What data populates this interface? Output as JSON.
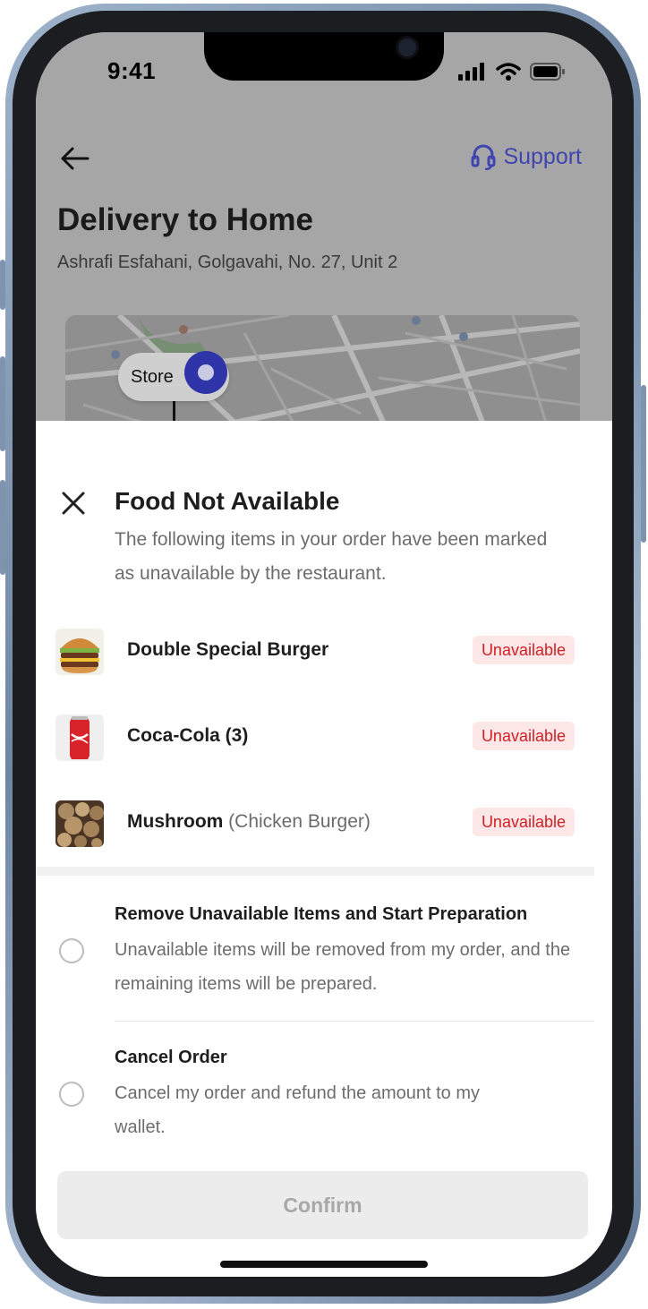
{
  "status_bar": {
    "time": "9:41"
  },
  "header": {
    "support_label": "Support",
    "title": "Delivery to Home",
    "address": "Ashrafi Esfahani, Golgavahi, No. 27, Unit 2"
  },
  "map": {
    "store_label": "Store"
  },
  "sheet": {
    "title": "Food Not Available",
    "description": "The following items in your order have been marked as unavailable by the restaurant.",
    "items": [
      {
        "name": "Double Special Burger",
        "note": "",
        "badge": "Unavailable",
        "icon": "burger-image"
      },
      {
        "name": "Coca-Cola (3)",
        "note": "",
        "badge": "Unavailable",
        "icon": "cola-can-image"
      },
      {
        "name": "Mushroom",
        "note": "(Chicken Burger)",
        "badge": "Unavailable",
        "icon": "mushroom-image"
      }
    ],
    "options": [
      {
        "title": "Remove Unavailable Items and Start Preparation",
        "description": "Unavailable items will be removed from my order, and the remaining items will be prepared.",
        "selected": false
      },
      {
        "title": "Cancel Order",
        "description": "Cancel my order and refund the amount to my wallet.",
        "selected": false
      }
    ],
    "confirm_label": "Confirm"
  },
  "colors": {
    "accent": "#3f44b0",
    "badge_text": "#d21f25",
    "badge_bg": "#fde7e7",
    "overlay": "#a6a6a6"
  }
}
